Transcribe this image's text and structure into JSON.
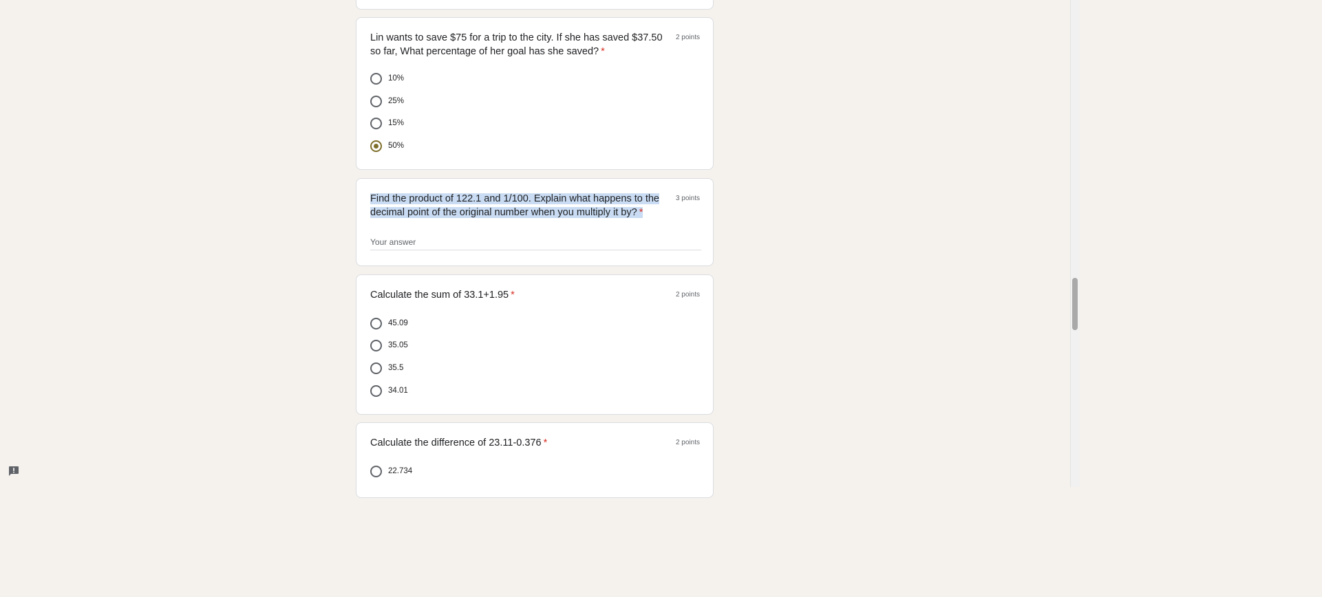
{
  "questions": [
    {
      "title": "Lin wants to save $75 for a trip to the city. If she has saved $37.50 so far, What percentage of her goal has she saved?",
      "required_mark": "*",
      "points": "2 points",
      "options": [
        "10%",
        "25%",
        "15%",
        "50%"
      ],
      "selected": "50%"
    },
    {
      "title": "Find the product of 122.1 and 1/100. Explain what happens to the decimal point of the original number when you multiply it by?",
      "required_mark": "*",
      "points": "3 points",
      "answer_placeholder": "Your answer",
      "answer_value": ""
    },
    {
      "title": "Calculate the sum of 33.1+1.95",
      "required_mark": "*",
      "points": "2 points",
      "options": [
        "45.09",
        "35.05",
        "35.5",
        "34.01"
      ]
    },
    {
      "title": "Calculate the difference of 23.11-0.376",
      "required_mark": "*",
      "points": "2 points",
      "options": [
        "22.734"
      ]
    }
  ],
  "icons": {
    "report": "report-problem-icon"
  },
  "colors": {
    "required": "#d93025",
    "selected_radio": "#7f6e2b",
    "highlight": "#c9dcf3",
    "page_background": "#f5f2ee"
  }
}
